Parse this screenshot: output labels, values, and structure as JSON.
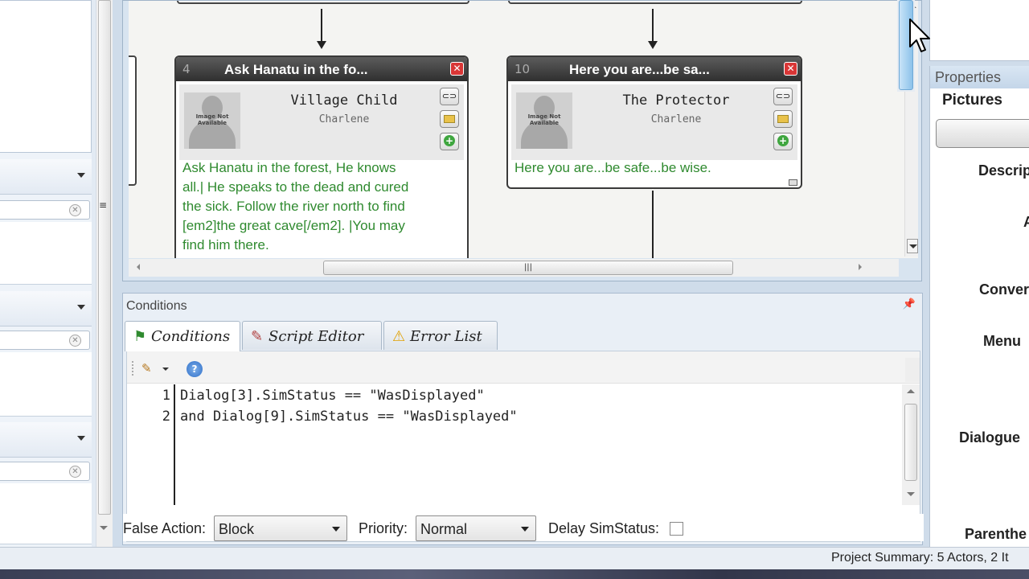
{
  "canvas": {
    "nodes": [
      {
        "number": "4",
        "title": "Ask Hanatu in the fo...",
        "actor": "Village Child",
        "subtitle": "Charlene",
        "image_label": "Image Not Available",
        "text": [
          "Ask Hanatu in the forest, He knows",
          "all.|  He speaks to the dead and cured",
          "the sick.  Follow the river north to find",
          "[em2]the great cave[/em2].  |You may",
          "find him there."
        ]
      },
      {
        "number": "10",
        "title": "Here you are...be sa...",
        "actor": "The Protector",
        "subtitle": "Charlene",
        "image_label": "Image Not Available",
        "text": [
          "Here you are...be safe...be wise."
        ]
      }
    ]
  },
  "conditions": {
    "panel_title": "Conditions",
    "tabs": [
      {
        "label": "Conditions",
        "icon": "conditions-icon",
        "active": true
      },
      {
        "label": "Script Editor",
        "icon": "script-icon",
        "active": false
      },
      {
        "label": "Error List",
        "icon": "warning-icon",
        "active": false
      }
    ],
    "lines": [
      {
        "num": "1",
        "code": "Dialog[3].SimStatus == \"WasDisplayed\""
      },
      {
        "num": "2",
        "code": "and Dialog[9].SimStatus == \"WasDisplayed\""
      }
    ],
    "false_action": {
      "label": "False Action:",
      "value": "Block"
    },
    "priority": {
      "label": "Priority:",
      "value": "Normal"
    },
    "delay": {
      "label": "Delay SimStatus:",
      "checked": false
    }
  },
  "properties": {
    "title": "Properties",
    "section": "Pictures",
    "labels": [
      "Descrip",
      "A",
      "Conver",
      "Menu",
      "Dialogue",
      "Parenthe"
    ]
  },
  "status": {
    "text": "Project Summary: 5 Actors, 2 It"
  },
  "colors": {
    "node_text": "#2f8a2f",
    "close": "#d93636",
    "accent": "#8cc2ea"
  }
}
